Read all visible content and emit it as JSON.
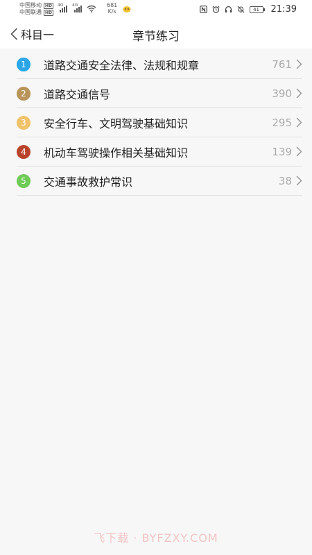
{
  "status_bar": {
    "carriers": [
      {
        "name": "中国移动",
        "badge": "HD"
      },
      {
        "name": "中国联通",
        "badge": "HD"
      }
    ],
    "signal_tags": [
      "4G",
      "4G"
    ],
    "speed_value": "681",
    "speed_unit": "K/s",
    "battery": "41",
    "time": "21:39"
  },
  "nav": {
    "back_label": "科目一",
    "title": "章节练习"
  },
  "chapters": [
    {
      "num": "1",
      "label": "道路交通安全法律、法规和规章",
      "count": "761",
      "color": "#2aa6e8"
    },
    {
      "num": "2",
      "label": "道路交通信号",
      "count": "390",
      "color": "#b8935a"
    },
    {
      "num": "3",
      "label": "安全行车、文明驾驶基础知识",
      "count": "295",
      "color": "#f0c26a"
    },
    {
      "num": "4",
      "label": "机动车驾驶操作相关基础知识",
      "count": "139",
      "color": "#b8432a"
    },
    {
      "num": "5",
      "label": "交通事故救护常识",
      "count": "38",
      "color": "#6ecb55"
    }
  ],
  "watermark": "飞下载 · BYFZXY.COM",
  "icons": {
    "back": "chevron-left-icon",
    "row_arrow": "chevron-right-icon",
    "wifi": "wifi-icon",
    "nfc": "nfc-icon",
    "alarm": "alarm-icon",
    "headphones": "headphones-icon",
    "mute": "bell-off-icon"
  }
}
